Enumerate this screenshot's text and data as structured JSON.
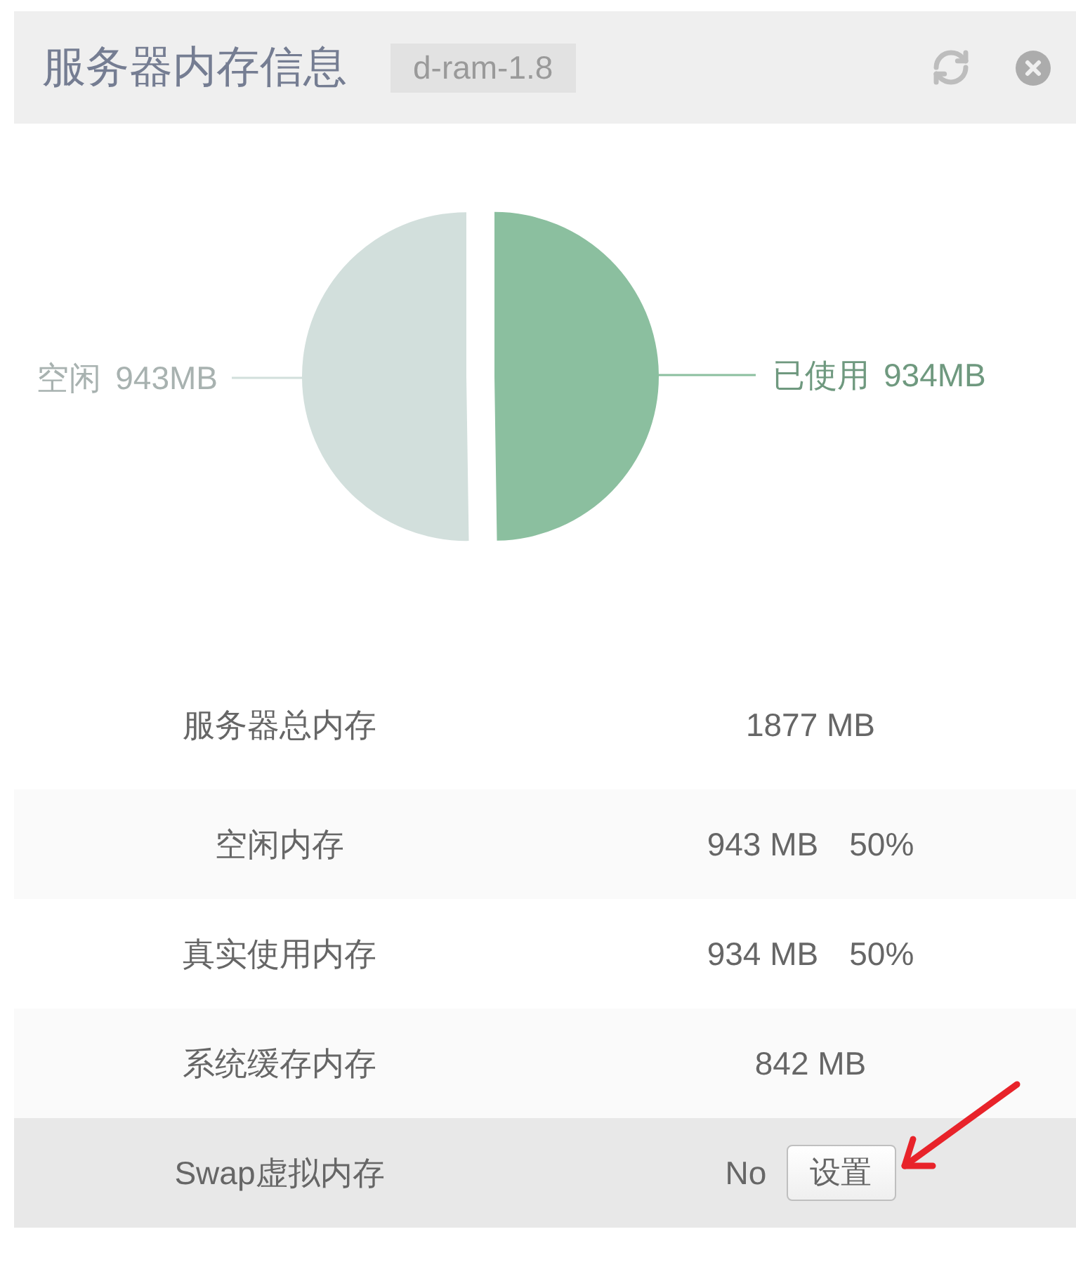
{
  "panel": {
    "title": "服务器内存信息",
    "version_badge": "d-ram-1.8"
  },
  "memory_chart": {
    "chart_data": {
      "type": "pie",
      "categories": [
        "空闲",
        "已使用"
      ],
      "values": [
        943,
        934
      ],
      "value_labels": [
        "943MB",
        "934MB"
      ]
    },
    "slices": [
      {
        "color": "#d2dfdc"
      },
      {
        "color": "#8bbf9f"
      }
    ]
  },
  "table": {
    "rows": [
      {
        "label": "服务器总内存",
        "value": "1877 MB",
        "hovered": false
      },
      {
        "label": "空闲内存",
        "value": "943 MB",
        "percent": "50%",
        "hovered": false
      },
      {
        "label": "真实使用内存",
        "value": "934 MB",
        "percent": "50%",
        "hovered": false
      },
      {
        "label": "系统缓存内存",
        "value": "842 MB",
        "hovered": false
      },
      {
        "label": "Swap虚拟内存",
        "value": "No",
        "button": "设置",
        "hovered": true
      }
    ]
  }
}
